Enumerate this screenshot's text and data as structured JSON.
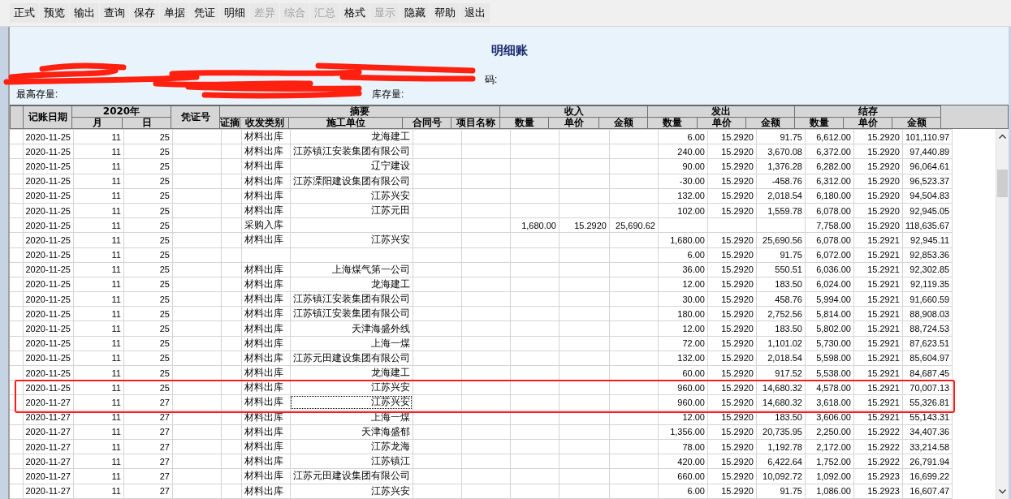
{
  "toolbar": [
    {
      "label": "正式",
      "disabled": false
    },
    {
      "label": "预览",
      "disabled": false
    },
    {
      "label": "输出",
      "disabled": false
    },
    {
      "label": "查询",
      "disabled": false
    },
    {
      "label": "保存",
      "disabled": false
    },
    {
      "label": "单据",
      "disabled": false
    },
    {
      "label": "凭证",
      "disabled": false
    },
    {
      "label": "明细",
      "disabled": false
    },
    {
      "label": "差异",
      "disabled": true
    },
    {
      "label": "综合",
      "disabled": true
    },
    {
      "label": "汇总",
      "disabled": true
    },
    {
      "label": "格式",
      "disabled": false
    },
    {
      "label": "显示",
      "disabled": true
    },
    {
      "label": "隐藏",
      "disabled": false
    },
    {
      "label": "帮助",
      "disabled": false
    },
    {
      "label": "退出",
      "disabled": false
    }
  ],
  "title": "明细账",
  "info_rows": [
    {
      "right": "码:"
    },
    {
      "left": "最高存量:",
      "middle": "库存量:"
    }
  ],
  "header": {
    "date": "记账日期",
    "year": "2020年",
    "month": "月",
    "day": "日",
    "voucher": "凭证号",
    "summary": "摘要",
    "summary_cols": [
      "证摘",
      "收发类别",
      "施工单位",
      "合同号",
      "项目名称"
    ],
    "groups": [
      {
        "label": "收入",
        "cols": [
          "数量",
          "单价",
          "金额"
        ]
      },
      {
        "label": "发出",
        "cols": [
          "数量",
          "单价",
          "金额"
        ]
      },
      {
        "label": "结存",
        "cols": [
          "数量",
          "单价",
          "金额"
        ]
      }
    ]
  },
  "rows": [
    {
      "date": "2020-11-25",
      "month": "11",
      "day": "25",
      "category": "材料出库",
      "unit": "龙海建工",
      "out_qty": "6.00",
      "out_price": "15.2920",
      "out_amount": "91.75",
      "bal_qty": "6,612.00",
      "bal_price": "15.2920",
      "bal_amount": "101,110.97",
      "marked": false,
      "focused": false
    },
    {
      "date": "2020-11-25",
      "month": "11",
      "day": "25",
      "category": "材料出库",
      "unit": "江苏镇江安装集团有限公司",
      "out_qty": "240.00",
      "out_price": "15.2920",
      "out_amount": "3,670.08",
      "bal_qty": "6,372.00",
      "bal_price": "15.2920",
      "bal_amount": "97,440.89",
      "marked": false,
      "focused": false
    },
    {
      "date": "2020-11-25",
      "month": "11",
      "day": "25",
      "category": "材料出库",
      "unit": "辽宁建设",
      "out_qty": "90.00",
      "out_price": "15.2920",
      "out_amount": "1,376.28",
      "bal_qty": "6,282.00",
      "bal_price": "15.2920",
      "bal_amount": "96,064.61",
      "marked": false,
      "focused": false
    },
    {
      "date": "2020-11-25",
      "month": "11",
      "day": "25",
      "category": "材料出库",
      "unit": "江苏溧阳建设集团有限公司",
      "out_qty": "-30.00",
      "out_price": "15.2920",
      "out_amount": "-458.76",
      "bal_qty": "6,312.00",
      "bal_price": "15.2920",
      "bal_amount": "96,523.37",
      "marked": false,
      "focused": false
    },
    {
      "date": "2020-11-25",
      "month": "11",
      "day": "25",
      "category": "材料出库",
      "unit": "江苏兴安",
      "out_qty": "132.00",
      "out_price": "15.2920",
      "out_amount": "2,018.54",
      "bal_qty": "6,180.00",
      "bal_price": "15.2920",
      "bal_amount": "94,504.83",
      "marked": false,
      "focused": false
    },
    {
      "date": "2020-11-25",
      "month": "11",
      "day": "25",
      "category": "材料出库",
      "unit": "江苏元田",
      "out_qty": "102.00",
      "out_price": "15.2920",
      "out_amount": "1,559.78",
      "bal_qty": "6,078.00",
      "bal_price": "15.2920",
      "bal_amount": "92,945.05",
      "marked": false,
      "focused": false
    },
    {
      "date": "2020-11-25",
      "month": "11",
      "day": "25",
      "category": "采购入库",
      "in_qty": "1,680.00",
      "in_price": "15.2920",
      "in_amount": "25,690.62",
      "bal_qty": "7,758.00",
      "bal_price": "15.2920",
      "bal_amount": "118,635.67",
      "marked": false,
      "focused": false
    },
    {
      "date": "2020-11-25",
      "month": "11",
      "day": "25",
      "category": "材料出库",
      "unit": "江苏兴安",
      "out_qty": "1,680.00",
      "out_price": "15.2920",
      "out_amount": "25,690.56",
      "bal_qty": "6,078.00",
      "bal_price": "15.2921",
      "bal_amount": "92,945.11",
      "marked": false,
      "focused": false
    },
    {
      "date": "2020-11-25",
      "month": "11",
      "day": "25",
      "out_qty": "6.00",
      "out_price": "15.2920",
      "out_amount": "91.75",
      "bal_qty": "6,072.00",
      "bal_price": "15.2921",
      "bal_amount": "92,853.36",
      "marked": false,
      "focused": false
    },
    {
      "date": "2020-11-25",
      "month": "11",
      "day": "25",
      "category": "材料出库",
      "unit": "上海煤气第一公司",
      "out_qty": "36.00",
      "out_price": "15.2920",
      "out_amount": "550.51",
      "bal_qty": "6,036.00",
      "bal_price": "15.2921",
      "bal_amount": "92,302.85",
      "marked": false,
      "focused": false
    },
    {
      "date": "2020-11-25",
      "month": "11",
      "day": "25",
      "category": "材料出库",
      "unit": "龙海建工",
      "out_qty": "12.00",
      "out_price": "15.2920",
      "out_amount": "183.50",
      "bal_qty": "6,024.00",
      "bal_price": "15.2921",
      "bal_amount": "92,119.35",
      "marked": false,
      "focused": false
    },
    {
      "date": "2020-11-25",
      "month": "11",
      "day": "25",
      "category": "材料出库",
      "unit": "江苏镇江安装集团有限公司",
      "out_qty": "30.00",
      "out_price": "15.2920",
      "out_amount": "458.76",
      "bal_qty": "5,994.00",
      "bal_price": "15.2921",
      "bal_amount": "91,660.59",
      "marked": false,
      "focused": false
    },
    {
      "date": "2020-11-25",
      "month": "11",
      "day": "25",
      "category": "材料出库",
      "unit": "江苏镇江安装集团有限公司",
      "out_qty": "180.00",
      "out_price": "15.2920",
      "out_amount": "2,752.56",
      "bal_qty": "5,814.00",
      "bal_price": "15.2921",
      "bal_amount": "88,908.03",
      "marked": false,
      "focused": false
    },
    {
      "date": "2020-11-25",
      "month": "11",
      "day": "25",
      "category": "材料出库",
      "unit": "天津海盛外线",
      "out_qty": "12.00",
      "out_price": "15.2920",
      "out_amount": "183.50",
      "bal_qty": "5,802.00",
      "bal_price": "15.2921",
      "bal_amount": "88,724.53",
      "marked": false,
      "focused": false
    },
    {
      "date": "2020-11-25",
      "month": "11",
      "day": "25",
      "category": "材料出库",
      "unit": "上海一煤",
      "out_qty": "72.00",
      "out_price": "15.2920",
      "out_amount": "1,101.02",
      "bal_qty": "5,730.00",
      "bal_price": "15.2921",
      "bal_amount": "87,623.51",
      "marked": false,
      "focused": false
    },
    {
      "date": "2020-11-25",
      "month": "11",
      "day": "25",
      "category": "材料出库",
      "unit": "江苏元田建设集团有限公司",
      "out_qty": "132.00",
      "out_price": "15.2920",
      "out_amount": "2,018.54",
      "bal_qty": "5,598.00",
      "bal_price": "15.2921",
      "bal_amount": "85,604.97",
      "marked": false,
      "focused": false
    },
    {
      "date": "2020-11-25",
      "month": "11",
      "day": "25",
      "category": "材料出库",
      "unit": "龙海建工",
      "out_qty": "60.00",
      "out_price": "15.2920",
      "out_amount": "917.52",
      "bal_qty": "5,538.00",
      "bal_price": "15.2921",
      "bal_amount": "84,687.45",
      "marked": false,
      "focused": false
    },
    {
      "date": "2020-11-25",
      "month": "11",
      "day": "25",
      "category": "材料出库",
      "unit": "江苏兴安",
      "out_qty": "960.00",
      "out_price": "15.2920",
      "out_amount": "14,680.32",
      "bal_qty": "4,578.00",
      "bal_price": "15.2921",
      "bal_amount": "70,007.13",
      "marked": true,
      "focused": false
    },
    {
      "date": "2020-11-27",
      "month": "11",
      "day": "27",
      "category": "材料出库",
      "unit": "江苏兴安",
      "out_qty": "960.00",
      "out_price": "15.2920",
      "out_amount": "14,680.32",
      "bal_qty": "3,618.00",
      "bal_price": "15.2921",
      "bal_amount": "55,326.81",
      "marked": true,
      "focused": true
    },
    {
      "date": "2020-11-27",
      "month": "11",
      "day": "27",
      "category": "材料出库",
      "unit": "上海一煤",
      "out_qty": "12.00",
      "out_price": "15.2920",
      "out_amount": "183.50",
      "bal_qty": "3,606.00",
      "bal_price": "15.2921",
      "bal_amount": "55,143.31",
      "marked": false,
      "focused": false
    },
    {
      "date": "2020-11-27",
      "month": "11",
      "day": "27",
      "category": "材料出库",
      "unit": "天津海盛郁",
      "out_qty": "1,356.00",
      "out_price": "15.2920",
      "out_amount": "20,735.95",
      "bal_qty": "2,250.00",
      "bal_price": "15.2922",
      "bal_amount": "34,407.36",
      "marked": false,
      "focused": false
    },
    {
      "date": "2020-11-27",
      "month": "11",
      "day": "27",
      "category": "材料出库",
      "unit": "江苏龙海",
      "out_qty": "78.00",
      "out_price": "15.2920",
      "out_amount": "1,192.78",
      "bal_qty": "2,172.00",
      "bal_price": "15.2922",
      "bal_amount": "33,214.58",
      "marked": false,
      "focused": false
    },
    {
      "date": "2020-11-27",
      "month": "11",
      "day": "27",
      "category": "材料出库",
      "unit": "江苏镇江",
      "out_qty": "420.00",
      "out_price": "15.2920",
      "out_amount": "6,422.64",
      "bal_qty": "1,752.00",
      "bal_price": "15.2922",
      "bal_amount": "26,791.94",
      "marked": false,
      "focused": false
    },
    {
      "date": "2020-11-27",
      "month": "11",
      "day": "27",
      "category": "材料出库",
      "unit": "江苏元田建设集团有限公司",
      "out_qty": "660.00",
      "out_price": "15.2920",
      "out_amount": "10,092.72",
      "bal_qty": "1,092.00",
      "bal_price": "15.2923",
      "bal_amount": "16,699.22",
      "marked": false,
      "focused": false
    },
    {
      "date": "2020-11-27",
      "month": "11",
      "day": "27",
      "category": "材料出库",
      "unit": "江苏兴安",
      "out_qty": "6.00",
      "out_price": "15.2920",
      "out_amount": "91.75",
      "bal_qty": "1,086.00",
      "bal_price": "15.2923",
      "bal_amount": "16,607.47",
      "marked": false,
      "focused": false
    }
  ]
}
